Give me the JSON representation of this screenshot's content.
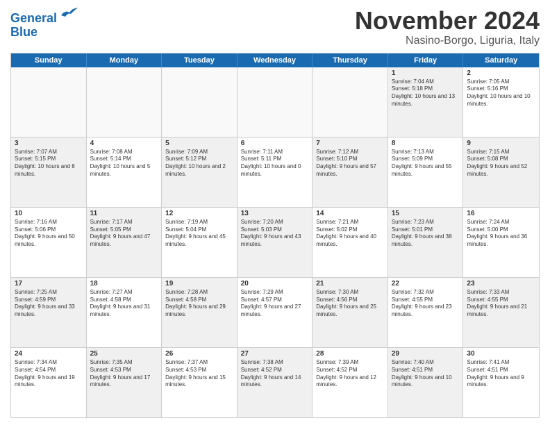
{
  "logo": {
    "line1": "General",
    "line2": "Blue"
  },
  "header": {
    "month": "November 2024",
    "location": "Nasino-Borgo, Liguria, Italy"
  },
  "weekdays": [
    "Sunday",
    "Monday",
    "Tuesday",
    "Wednesday",
    "Thursday",
    "Friday",
    "Saturday"
  ],
  "rows": [
    [
      {
        "day": "",
        "text": "",
        "empty": true
      },
      {
        "day": "",
        "text": "",
        "empty": true
      },
      {
        "day": "",
        "text": "",
        "empty": true
      },
      {
        "day": "",
        "text": "",
        "empty": true
      },
      {
        "day": "",
        "text": "",
        "empty": true
      },
      {
        "day": "1",
        "text": "Sunrise: 7:04 AM\nSunset: 5:18 PM\nDaylight: 10 hours and 13 minutes.",
        "shaded": true
      },
      {
        "day": "2",
        "text": "Sunrise: 7:05 AM\nSunset: 5:16 PM\nDaylight: 10 hours and 10 minutes.",
        "shaded": false
      }
    ],
    [
      {
        "day": "3",
        "text": "Sunrise: 7:07 AM\nSunset: 5:15 PM\nDaylight: 10 hours and 8 minutes.",
        "shaded": true
      },
      {
        "day": "4",
        "text": "Sunrise: 7:08 AM\nSunset: 5:14 PM\nDaylight: 10 hours and 5 minutes.",
        "shaded": false
      },
      {
        "day": "5",
        "text": "Sunrise: 7:09 AM\nSunset: 5:12 PM\nDaylight: 10 hours and 2 minutes.",
        "shaded": true
      },
      {
        "day": "6",
        "text": "Sunrise: 7:11 AM\nSunset: 5:11 PM\nDaylight: 10 hours and 0 minutes.",
        "shaded": false
      },
      {
        "day": "7",
        "text": "Sunrise: 7:12 AM\nSunset: 5:10 PM\nDaylight: 9 hours and 57 minutes.",
        "shaded": true
      },
      {
        "day": "8",
        "text": "Sunrise: 7:13 AM\nSunset: 5:09 PM\nDaylight: 9 hours and 55 minutes.",
        "shaded": false
      },
      {
        "day": "9",
        "text": "Sunrise: 7:15 AM\nSunset: 5:08 PM\nDaylight: 9 hours and 52 minutes.",
        "shaded": true
      }
    ],
    [
      {
        "day": "10",
        "text": "Sunrise: 7:16 AM\nSunset: 5:06 PM\nDaylight: 9 hours and 50 minutes.",
        "shaded": false
      },
      {
        "day": "11",
        "text": "Sunrise: 7:17 AM\nSunset: 5:05 PM\nDaylight: 9 hours and 47 minutes.",
        "shaded": true
      },
      {
        "day": "12",
        "text": "Sunrise: 7:19 AM\nSunset: 5:04 PM\nDaylight: 9 hours and 45 minutes.",
        "shaded": false
      },
      {
        "day": "13",
        "text": "Sunrise: 7:20 AM\nSunset: 5:03 PM\nDaylight: 9 hours and 43 minutes.",
        "shaded": true
      },
      {
        "day": "14",
        "text": "Sunrise: 7:21 AM\nSunset: 5:02 PM\nDaylight: 9 hours and 40 minutes.",
        "shaded": false
      },
      {
        "day": "15",
        "text": "Sunrise: 7:23 AM\nSunset: 5:01 PM\nDaylight: 9 hours and 38 minutes.",
        "shaded": true
      },
      {
        "day": "16",
        "text": "Sunrise: 7:24 AM\nSunset: 5:00 PM\nDaylight: 9 hours and 36 minutes.",
        "shaded": false
      }
    ],
    [
      {
        "day": "17",
        "text": "Sunrise: 7:25 AM\nSunset: 4:59 PM\nDaylight: 9 hours and 33 minutes.",
        "shaded": true
      },
      {
        "day": "18",
        "text": "Sunrise: 7:27 AM\nSunset: 4:58 PM\nDaylight: 9 hours and 31 minutes.",
        "shaded": false
      },
      {
        "day": "19",
        "text": "Sunrise: 7:28 AM\nSunset: 4:58 PM\nDaylight: 9 hours and 29 minutes.",
        "shaded": true
      },
      {
        "day": "20",
        "text": "Sunrise: 7:29 AM\nSunset: 4:57 PM\nDaylight: 9 hours and 27 minutes.",
        "shaded": false
      },
      {
        "day": "21",
        "text": "Sunrise: 7:30 AM\nSunset: 4:56 PM\nDaylight: 9 hours and 25 minutes.",
        "shaded": true
      },
      {
        "day": "22",
        "text": "Sunrise: 7:32 AM\nSunset: 4:55 PM\nDaylight: 9 hours and 23 minutes.",
        "shaded": false
      },
      {
        "day": "23",
        "text": "Sunrise: 7:33 AM\nSunset: 4:55 PM\nDaylight: 9 hours and 21 minutes.",
        "shaded": true
      }
    ],
    [
      {
        "day": "24",
        "text": "Sunrise: 7:34 AM\nSunset: 4:54 PM\nDaylight: 9 hours and 19 minutes.",
        "shaded": false
      },
      {
        "day": "25",
        "text": "Sunrise: 7:35 AM\nSunset: 4:53 PM\nDaylight: 9 hours and 17 minutes.",
        "shaded": true
      },
      {
        "day": "26",
        "text": "Sunrise: 7:37 AM\nSunset: 4:53 PM\nDaylight: 9 hours and 15 minutes.",
        "shaded": false
      },
      {
        "day": "27",
        "text": "Sunrise: 7:38 AM\nSunset: 4:52 PM\nDaylight: 9 hours and 14 minutes.",
        "shaded": true
      },
      {
        "day": "28",
        "text": "Sunrise: 7:39 AM\nSunset: 4:52 PM\nDaylight: 9 hours and 12 minutes.",
        "shaded": false
      },
      {
        "day": "29",
        "text": "Sunrise: 7:40 AM\nSunset: 4:51 PM\nDaylight: 9 hours and 10 minutes.",
        "shaded": true
      },
      {
        "day": "30",
        "text": "Sunrise: 7:41 AM\nSunset: 4:51 PM\nDaylight: 9 hours and 9 minutes.",
        "shaded": false
      }
    ]
  ]
}
